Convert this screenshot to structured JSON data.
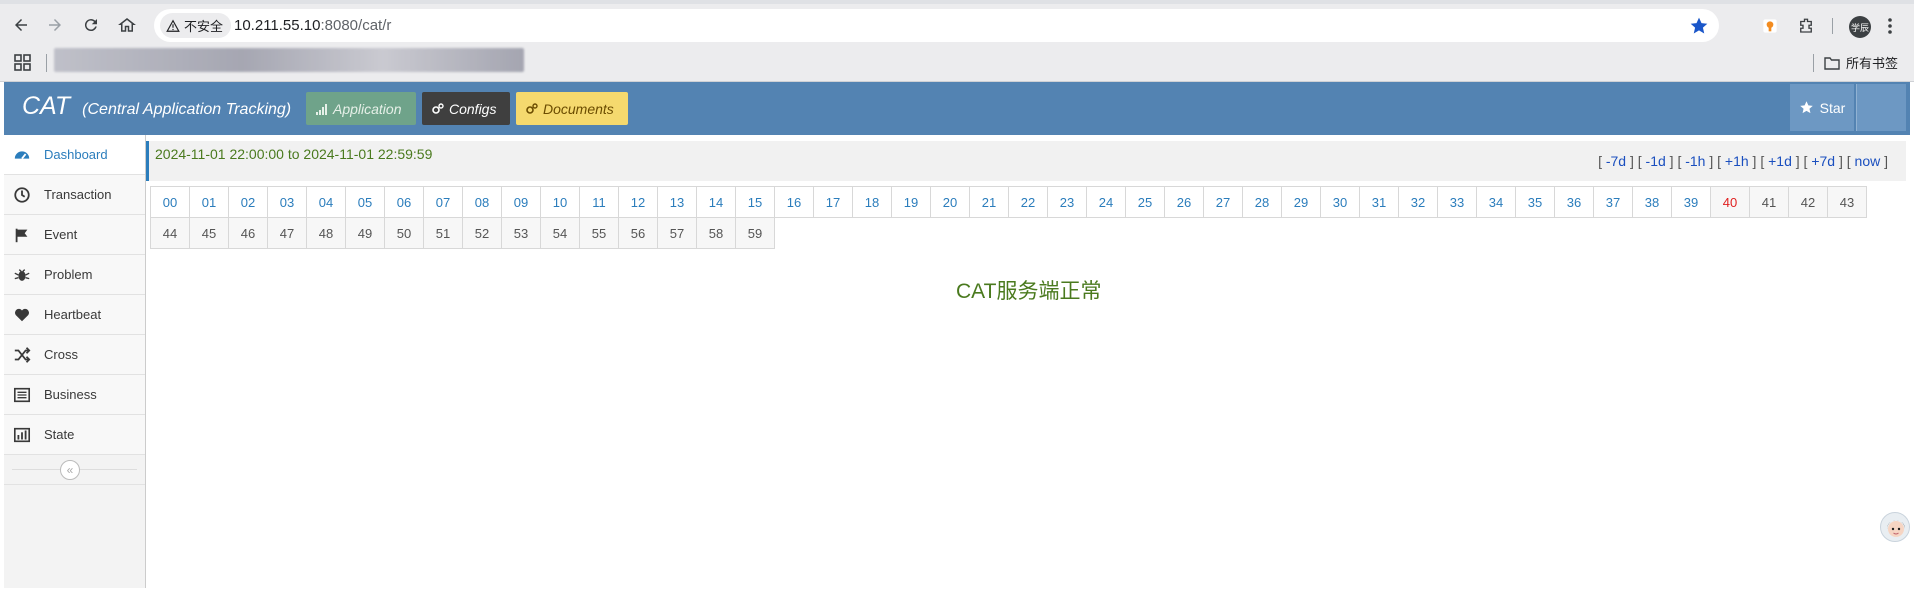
{
  "browser": {
    "security_label": "不安全",
    "url_host": "10.211.55.10",
    "url_rest": ":8080/cat/r",
    "all_bookmarks_label": "所有书签",
    "profile_label": "学辰"
  },
  "header": {
    "brand": "CAT",
    "brand_sub": "(Central Application Tracking)",
    "buttons": {
      "application": "Application",
      "configs": "Configs",
      "documents": "Documents"
    },
    "star_label": "Star"
  },
  "sidebar": {
    "items": [
      {
        "label": "Dashboard",
        "icon": "dashboard-icon"
      },
      {
        "label": "Transaction",
        "icon": "clock-icon"
      },
      {
        "label": "Event",
        "icon": "flag-icon"
      },
      {
        "label": "Problem",
        "icon": "bug-icon"
      },
      {
        "label": "Heartbeat",
        "icon": "heart-icon"
      },
      {
        "label": "Cross",
        "icon": "shuffle-icon"
      },
      {
        "label": "Business",
        "icon": "list-icon"
      },
      {
        "label": "State",
        "icon": "bar-chart-icon"
      }
    ],
    "active_index": 0,
    "collapse_glyph": "«"
  },
  "main": {
    "time_range": "2024-11-01 22:00:00 to 2024-11-01 22:59:59",
    "nav_links": [
      "-7d",
      "-1d",
      "-1h",
      "+1h",
      "+1d",
      "+7d",
      "now"
    ],
    "minute_row1": [
      "00",
      "01",
      "02",
      "03",
      "04",
      "05",
      "06",
      "07",
      "08",
      "09",
      "10",
      "11",
      "12",
      "13",
      "14",
      "15",
      "16",
      "17",
      "18",
      "19",
      "20",
      "21",
      "22",
      "23",
      "24",
      "25",
      "26",
      "27",
      "28",
      "29",
      "30",
      "31",
      "32",
      "33",
      "34",
      "35",
      "36",
      "37",
      "38",
      "39",
      "40",
      "41",
      "42",
      "43"
    ],
    "minute_row2": [
      "44",
      "45",
      "46",
      "47",
      "48",
      "49",
      "50",
      "51",
      "52",
      "53",
      "54",
      "55",
      "56",
      "57",
      "58",
      "59"
    ],
    "current_minute": "40",
    "status_message": "CAT服务端正常"
  },
  "colors": {
    "header_bg": "#5383b2",
    "link_blue": "#2b7dbc",
    "status_green": "#4a7a1e",
    "current_red": "#e02020"
  }
}
